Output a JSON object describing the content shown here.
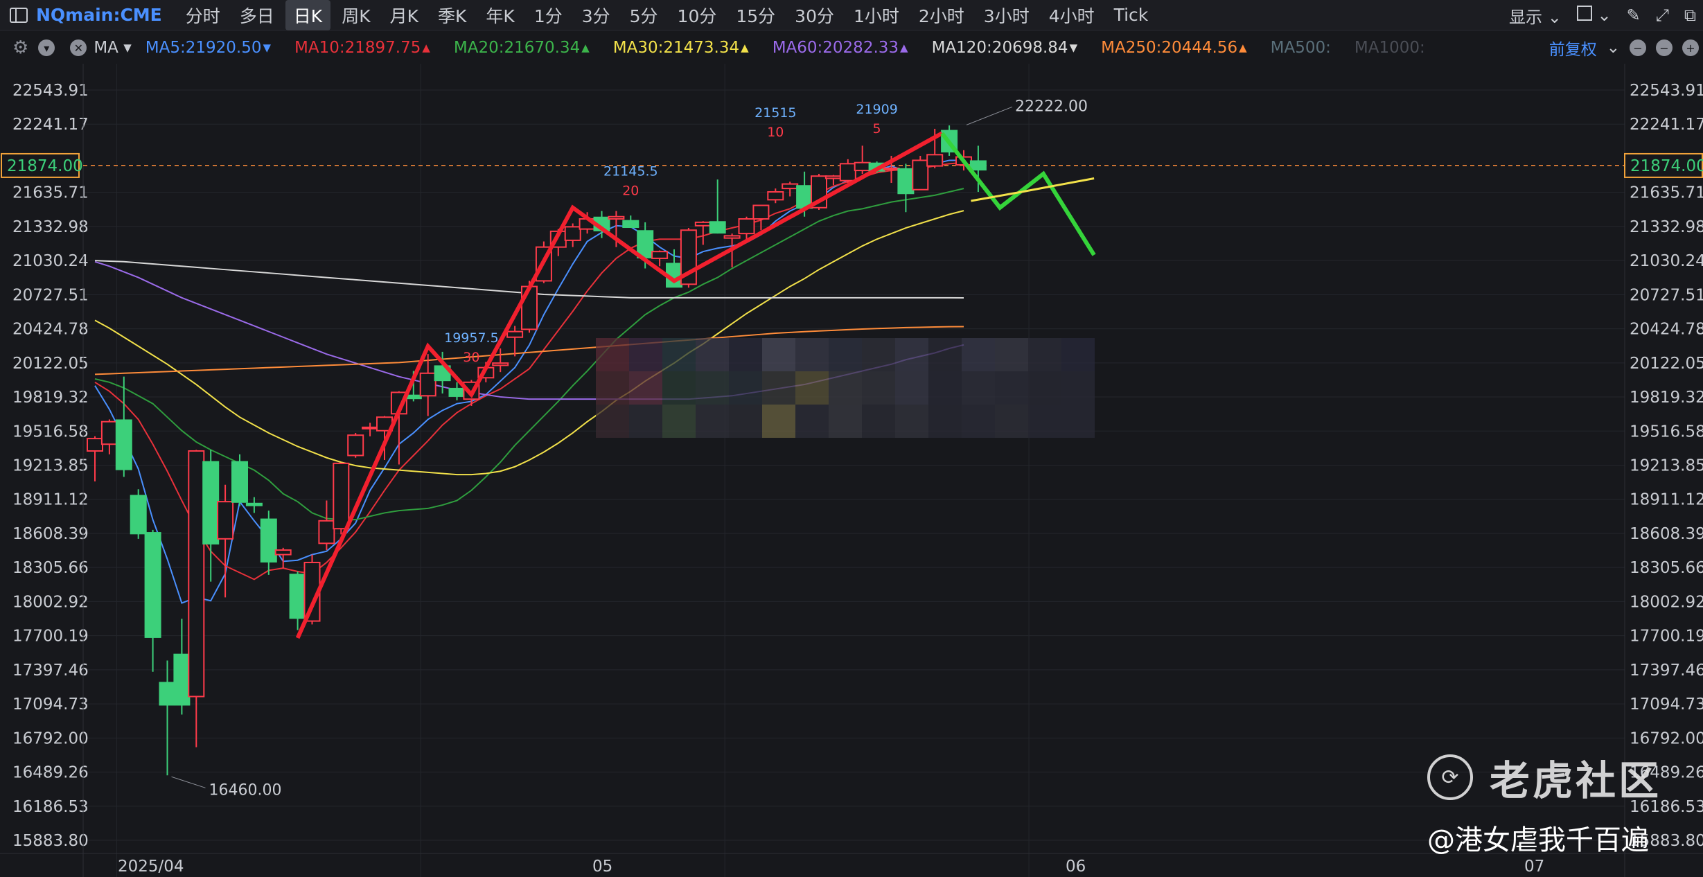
{
  "toolbar": {
    "symbol": "NQmain:CME",
    "timeframes": [
      "分时",
      "多日",
      "日K",
      "周K",
      "月K",
      "季K",
      "年K",
      "1分",
      "3分",
      "5分",
      "10分",
      "15分",
      "30分",
      "1小时",
      "2小时",
      "3小时",
      "4小时",
      "Tick"
    ],
    "active_timeframe": "日K",
    "display_label": "显示",
    "adjust_label": "前复权"
  },
  "ma_bar": {
    "indicator": "MA",
    "items": [
      {
        "label": "MA5:21920.50",
        "color": "#4a90ff",
        "arrow": "▾"
      },
      {
        "label": "MA10:21897.75",
        "color": "#e8313a",
        "arrow": "▴"
      },
      {
        "label": "MA20:21670.34",
        "color": "#3cb44b",
        "arrow": "▴"
      },
      {
        "label": "MA30:21473.34",
        "color": "#f2e14a",
        "arrow": "▴"
      },
      {
        "label": "MA60:20282.33",
        "color": "#9b6bea",
        "arrow": "▴"
      },
      {
        "label": "MA120:20698.84",
        "color": "#d8d8d8",
        "arrow": "▾"
      },
      {
        "label": "MA250:20444.56",
        "color": "#ff8c3a",
        "arrow": "▴"
      },
      {
        "label": "MA500:",
        "color": "#5a6f7a",
        "arrow": ""
      },
      {
        "label": "MA1000:",
        "color": "#4a4d55",
        "arrow": ""
      }
    ]
  },
  "chart_data": {
    "type": "candlestick",
    "y_ticks": [
      "22543.91",
      "22241.17",
      "21874.00",
      "21635.71",
      "21332.98",
      "21030.24",
      "20727.51",
      "20424.78",
      "20122.05",
      "19819.32",
      "19516.58",
      "19213.85",
      "18911.12",
      "18608.39",
      "18305.66",
      "18002.92",
      "17700.19",
      "17397.46",
      "17094.73",
      "16792.00",
      "16489.26",
      "16186.53",
      "15883.80"
    ],
    "current_price": 21874.0,
    "x_labels": [
      "2025/04",
      "05",
      "06",
      "07"
    ],
    "candles": [
      {
        "o": 19340,
        "h": 19470,
        "l": 19070,
        "c": 19450
      },
      {
        "o": 19400,
        "h": 19620,
        "l": 19310,
        "c": 19600
      },
      {
        "o": 19620,
        "h": 20000,
        "l": 19110,
        "c": 19170
      },
      {
        "o": 18950,
        "h": 19000,
        "l": 18560,
        "c": 18600
      },
      {
        "o": 18620,
        "h": 18640,
        "l": 17380,
        "c": 17680
      },
      {
        "o": 17290,
        "h": 17480,
        "l": 16460,
        "c": 17080
      },
      {
        "o": 17540,
        "h": 17850,
        "l": 17000,
        "c": 17080
      },
      {
        "o": 17160,
        "h": 19350,
        "l": 16710,
        "c": 19340
      },
      {
        "o": 19250,
        "h": 19350,
        "l": 18180,
        "c": 18510
      },
      {
        "o": 18560,
        "h": 19040,
        "l": 18040,
        "c": 18890
      },
      {
        "o": 19250,
        "h": 19310,
        "l": 18850,
        "c": 18880
      },
      {
        "o": 18880,
        "h": 18930,
        "l": 18790,
        "c": 18850
      },
      {
        "o": 18740,
        "h": 18810,
        "l": 18240,
        "c": 18350
      },
      {
        "o": 18420,
        "h": 18480,
        "l": 18300,
        "c": 18460
      },
      {
        "o": 18250,
        "h": 18270,
        "l": 17750,
        "c": 17850
      },
      {
        "o": 17830,
        "h": 18420,
        "l": 17800,
        "c": 18350
      },
      {
        "o": 18520,
        "h": 18900,
        "l": 18460,
        "c": 18720
      },
      {
        "o": 18650,
        "h": 19230,
        "l": 18600,
        "c": 19230
      },
      {
        "o": 19300,
        "h": 19500,
        "l": 19280,
        "c": 19480
      },
      {
        "o": 19540,
        "h": 19590,
        "l": 19470,
        "c": 19550
      },
      {
        "o": 19520,
        "h": 19650,
        "l": 19260,
        "c": 19640
      },
      {
        "o": 19670,
        "h": 19870,
        "l": 19220,
        "c": 19860
      },
      {
        "o": 19840,
        "h": 20050,
        "l": 19780,
        "c": 19800
      },
      {
        "o": 19830,
        "h": 20200,
        "l": 19650,
        "c": 20030
      },
      {
        "o": 20100,
        "h": 20220,
        "l": 19850,
        "c": 19960
      },
      {
        "o": 19900,
        "h": 19950,
        "l": 19790,
        "c": 19820
      },
      {
        "o": 19800,
        "h": 19970,
        "l": 19740,
        "c": 19950
      },
      {
        "o": 19990,
        "h": 20130,
        "l": 19950,
        "c": 20080
      },
      {
        "o": 20100,
        "h": 20250,
        "l": 20040,
        "c": 20120
      },
      {
        "o": 20350,
        "h": 20450,
        "l": 20180,
        "c": 20400
      },
      {
        "o": 20420,
        "h": 20850,
        "l": 20390,
        "c": 20800
      },
      {
        "o": 20850,
        "h": 21200,
        "l": 20830,
        "c": 21150
      },
      {
        "o": 21150,
        "h": 21310,
        "l": 21070,
        "c": 21290
      },
      {
        "o": 21210,
        "h": 21360,
        "l": 21150,
        "c": 21330
      },
      {
        "o": 21310,
        "h": 21460,
        "l": 21270,
        "c": 21400
      },
      {
        "o": 21420,
        "h": 21470,
        "l": 21230,
        "c": 21290
      },
      {
        "o": 21400,
        "h": 21470,
        "l": 21150,
        "c": 21420
      },
      {
        "o": 21390,
        "h": 21430,
        "l": 21320,
        "c": 21320
      },
      {
        "o": 21300,
        "h": 21370,
        "l": 20960,
        "c": 21050
      },
      {
        "o": 21050,
        "h": 21120,
        "l": 20980,
        "c": 21110
      },
      {
        "o": 21010,
        "h": 21130,
        "l": 20820,
        "c": 20790
      },
      {
        "o": 20820,
        "h": 21320,
        "l": 20790,
        "c": 21300
      },
      {
        "o": 21340,
        "h": 21380,
        "l": 21170,
        "c": 21370
      },
      {
        "o": 21380,
        "h": 21750,
        "l": 21270,
        "c": 21270
      },
      {
        "o": 21230,
        "h": 21270,
        "l": 20970,
        "c": 21250
      },
      {
        "o": 21270,
        "h": 21420,
        "l": 21220,
        "c": 21400
      },
      {
        "o": 21400,
        "h": 21520,
        "l": 21300,
        "c": 21520
      },
      {
        "o": 21570,
        "h": 21670,
        "l": 21540,
        "c": 21640
      },
      {
        "o": 21670,
        "h": 21730,
        "l": 21600,
        "c": 21710
      },
      {
        "o": 21700,
        "h": 21820,
        "l": 21420,
        "c": 21490
      },
      {
        "o": 21500,
        "h": 21800,
        "l": 21480,
        "c": 21780
      },
      {
        "o": 21760,
        "h": 21790,
        "l": 21700,
        "c": 21780
      },
      {
        "o": 21740,
        "h": 21930,
        "l": 21720,
        "c": 21890
      },
      {
        "o": 21830,
        "h": 22050,
        "l": 21800,
        "c": 21900
      },
      {
        "o": 21900,
        "h": 21910,
        "l": 21810,
        "c": 21820
      },
      {
        "o": 21850,
        "h": 21960,
        "l": 21720,
        "c": 21850
      },
      {
        "o": 21850,
        "h": 21890,
        "l": 21460,
        "c": 21620
      },
      {
        "o": 21660,
        "h": 21960,
        "l": 21660,
        "c": 21920
      },
      {
        "o": 21870,
        "h": 22200,
        "l": 21850,
        "c": 21970
      },
      {
        "o": 22190,
        "h": 22230,
        "l": 21960,
        "c": 21990
      },
      {
        "o": 21880,
        "h": 22010,
        "l": 21830,
        "c": 21950
      },
      {
        "o": 21920,
        "h": 22050,
        "l": 21640,
        "c": 21830
      }
    ],
    "annotations": [
      {
        "label": "16460.00",
        "price": 16460,
        "index": 5
      },
      {
        "label": "19957.5",
        "sub": "30",
        "price": 20122,
        "index": 26
      },
      {
        "label": "21145.5",
        "sub": "20",
        "price": 21600,
        "index": 37
      },
      {
        "label": "21515",
        "sub": "10",
        "price": 22120,
        "index": 47
      },
      {
        "label": "21909",
        "sub": "5",
        "price": 22150,
        "index": 54
      },
      {
        "label": "22222.00",
        "price": 22222,
        "index": 60
      }
    ],
    "ma_lines": {
      "MA5": [
        19920,
        19710,
        19450,
        19180,
        18730,
        18380,
        17990,
        18040,
        18010,
        18250,
        18890,
        18720,
        18560,
        18360,
        18370,
        18420,
        18450,
        18560,
        18700,
        18990,
        19190,
        19400,
        19500,
        19620,
        19700,
        19760,
        19780,
        19840,
        19960,
        20080,
        20280,
        20550,
        20780,
        21000,
        21200,
        21280,
        21340,
        21330,
        21250,
        21150,
        21070,
        21050,
        21110,
        21140,
        21160,
        21190,
        21260,
        21380,
        21470,
        21530,
        21580,
        21680,
        21740,
        21770,
        21830,
        21870,
        21820,
        21840,
        21890,
        21920,
        21920
      ],
      "MA10": [
        19950,
        19870,
        19760,
        19620,
        19400,
        19160,
        18900,
        18650,
        18450,
        18320,
        18260,
        18200,
        18280,
        18300,
        18270,
        18250,
        18350,
        18480,
        18620,
        18800,
        18990,
        19170,
        19300,
        19430,
        19570,
        19680,
        19760,
        19830,
        19890,
        19980,
        20070,
        20240,
        20410,
        20580,
        20760,
        20920,
        21050,
        21140,
        21200,
        21220,
        21220,
        21220,
        21250,
        21290,
        21320,
        21350,
        21390,
        21450,
        21490,
        21560,
        21630,
        21690,
        21730,
        21770,
        21810,
        21830,
        21840,
        21850,
        21870,
        21890,
        21900
      ],
      "MA20": [
        19980,
        19950,
        19900,
        19830,
        19760,
        19640,
        19520,
        19420,
        19350,
        19290,
        19230,
        19170,
        19080,
        18960,
        18890,
        18790,
        18740,
        18730,
        18730,
        18760,
        18790,
        18810,
        18820,
        18830,
        18860,
        18900,
        18990,
        19110,
        19240,
        19390,
        19520,
        19650,
        19780,
        19920,
        20050,
        20190,
        20330,
        20440,
        20550,
        20630,
        20700,
        20750,
        20820,
        20880,
        20960,
        21030,
        21100,
        21170,
        21240,
        21310,
        21380,
        21430,
        21470,
        21490,
        21520,
        21550,
        21570,
        21590,
        21610,
        21640,
        21670
      ],
      "MA30": [
        20500,
        20430,
        20350,
        20270,
        20190,
        20110,
        20020,
        19930,
        19830,
        19730,
        19640,
        19570,
        19500,
        19440,
        19380,
        19330,
        19280,
        19240,
        19210,
        19190,
        19180,
        19170,
        19160,
        19150,
        19140,
        19130,
        19130,
        19140,
        19160,
        19200,
        19260,
        19330,
        19410,
        19500,
        19600,
        19690,
        19790,
        19870,
        19960,
        20040,
        20120,
        20210,
        20290,
        20380,
        20470,
        20560,
        20640,
        20720,
        20800,
        20870,
        20950,
        21020,
        21090,
        21160,
        21220,
        21270,
        21320,
        21360,
        21400,
        21440,
        21473
      ],
      "MA60": [
        21020,
        20980,
        20930,
        20880,
        20820,
        20760,
        20700,
        20650,
        20600,
        20550,
        20500,
        20450,
        20400,
        20350,
        20300,
        20250,
        20200,
        20160,
        20120,
        20080,
        20040,
        20000,
        19970,
        19940,
        19910,
        19880,
        19860,
        19840,
        19820,
        19810,
        19800,
        19800,
        19800,
        19800,
        19800,
        19800,
        19800,
        19800,
        19800,
        19800,
        19800,
        19800,
        19810,
        19820,
        19830,
        19850,
        19870,
        19890,
        19910,
        19930,
        19960,
        19990,
        20020,
        20050,
        20080,
        20110,
        20150,
        20180,
        20210,
        20250,
        20282
      ],
      "MA120": [
        21030,
        21025,
        21020,
        21010,
        21000,
        20990,
        20980,
        20970,
        20960,
        20950,
        20940,
        20930,
        20920,
        20910,
        20900,
        20890,
        20880,
        20870,
        20860,
        20850,
        20840,
        20830,
        20820,
        20810,
        20800,
        20790,
        20780,
        20770,
        20760,
        20750,
        20740,
        20730,
        20725,
        20720,
        20715,
        20710,
        20705,
        20700,
        20700,
        20700,
        20700,
        20700,
        20700,
        20700,
        20700,
        20700,
        20700,
        20700,
        20700,
        20700,
        20700,
        20700,
        20700,
        20700,
        20700,
        20700,
        20700,
        20700,
        20700,
        20700,
        20699
      ],
      "MA250": [
        20020,
        20025,
        20030,
        20035,
        20040,
        20045,
        20050,
        20055,
        20060,
        20065,
        20070,
        20075,
        20080,
        20085,
        20090,
        20095,
        20100,
        20105,
        20110,
        20115,
        20120,
        20125,
        20135,
        20145,
        20155,
        20165,
        20175,
        20185,
        20195,
        20205,
        20215,
        20225,
        20235,
        20245,
        20255,
        20265,
        20275,
        20285,
        20295,
        20305,
        20315,
        20325,
        20335,
        20345,
        20355,
        20365,
        20375,
        20385,
        20392,
        20399,
        20405,
        20411,
        20417,
        20422,
        20427,
        20431,
        20435,
        20438,
        20441,
        20443,
        20444
      ]
    },
    "trend_red": [
      {
        "i": 14,
        "p": 17680
      },
      {
        "i": 23,
        "p": 20270
      },
      {
        "i": 26,
        "p": 19840
      },
      {
        "i": 33,
        "p": 21500
      },
      {
        "i": 40,
        "p": 20850
      },
      {
        "i": 58.5,
        "p": 22160
      }
    ],
    "trend_green": [
      {
        "i": 58.5,
        "p": 22160
      },
      {
        "i": 62.5,
        "p": 21500
      },
      {
        "i": 65.5,
        "p": 21800
      },
      {
        "i": 69,
        "p": 21080
      }
    ],
    "grid": true
  },
  "watermark": {
    "brand": "老虎社区",
    "user": "@港女虐我千百遍"
  }
}
